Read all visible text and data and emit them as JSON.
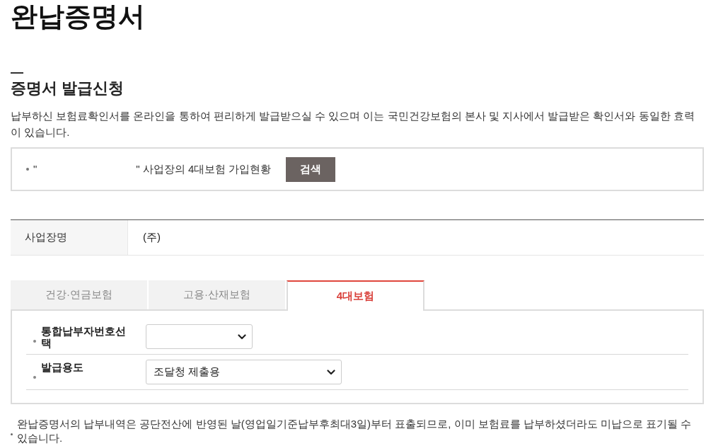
{
  "page_title": "완납증명서",
  "section": {
    "title": "증명서 발급신청",
    "description": "납부하신 보험료확인서를 온라인을 통하여 편리하게 발급받으실 수 있으며 이는 국민건강보험의 본사 및 지사에서 발급받은 확인서와 동일한 효력이 있습니다."
  },
  "search_box": {
    "quote_open": "\"",
    "quote_close_text": "\" 사업장의 4대보험 가입현황",
    "button": "검색"
  },
  "info_table": {
    "rows": [
      {
        "label": "사업장명",
        "value": "(주)"
      }
    ]
  },
  "tabs": [
    {
      "label": "건강·연금보험",
      "selected": false
    },
    {
      "label": "고용·산재보험",
      "selected": false
    },
    {
      "label": "4대보험",
      "selected": true
    }
  ],
  "form": {
    "fields": [
      {
        "label": "통합납부자번호선택"
      },
      {
        "label": "발급용도",
        "value": "조달청 제출용"
      }
    ]
  },
  "notes": [
    "완납증명서의 납부내역은 공단전산에 반영된 날(영업일기준납부후최대3일)부터 표출되므로, 이미 보험료를 납부하셨더라도 미납으로 표기될 수 있습니다."
  ]
}
